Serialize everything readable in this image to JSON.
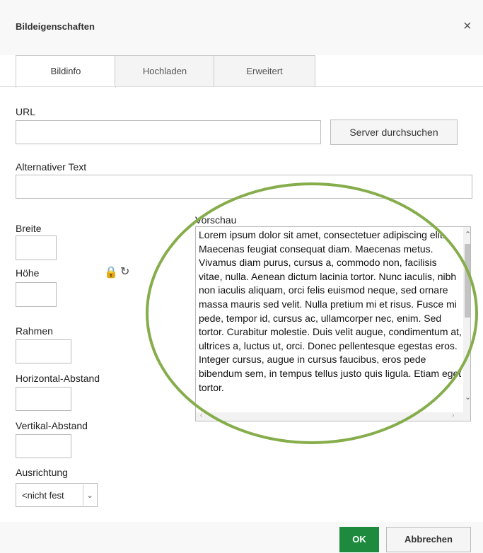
{
  "dialog": {
    "title": "Bildeigenschaften",
    "close_icon": "×"
  },
  "tabs": [
    {
      "label": "Bildinfo"
    },
    {
      "label": "Hochladen"
    },
    {
      "label": "Erweitert"
    }
  ],
  "form": {
    "url_label": "URL",
    "url_value": "",
    "browse_label": "Server durchsuchen",
    "alt_label": "Alternativer Text",
    "alt_value": "",
    "width_label": "Breite",
    "height_label": "Höhe",
    "border_label": "Rahmen",
    "hspace_label": "Horizontal-Abstand",
    "vspace_label": "Vertikal-Abstand",
    "align_label": "Ausrichtung",
    "align_value": "<nicht fest"
  },
  "preview": {
    "label": "Vorschau",
    "text": "Lorem ipsum dolor sit amet, consectetuer adipiscing elit. Maecenas feugiat consequat diam. Maecenas metus. Vivamus diam purus, cursus a, commodo non, facilisis vitae, nulla. Aenean dictum lacinia tortor. Nunc iaculis, nibh non iaculis aliquam, orci felis euismod neque, sed ornare massa mauris sed velit. Nulla pretium mi et risus. Fusce mi pede, tempor id, cursus ac, ullamcorper nec, enim. Sed tortor. Curabitur molestie. Duis velit augue, condimentum at, ultrices a, luctus ut, orci. Donec pellentesque egestas eros. Integer cursus, augue in cursus faucibus, eros pede bibendum sem, in tempus tellus justo quis ligula. Etiam eget tortor."
  },
  "footer": {
    "ok_label": "OK",
    "cancel_label": "Abbrechen"
  },
  "colors": {
    "ok": "#1d8a3d",
    "highlight": "#86ad4b"
  }
}
